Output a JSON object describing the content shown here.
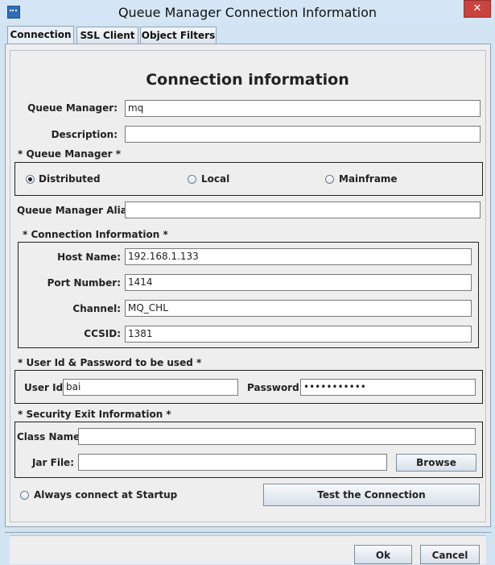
{
  "window": {
    "title": "Queue Manager Connection Information",
    "close_glyph": "✕"
  },
  "tabs": [
    {
      "label": "Connection",
      "active": true
    },
    {
      "label": "SSL Client",
      "active": false
    },
    {
      "label": "Object Filters",
      "active": false
    }
  ],
  "form": {
    "heading": "Connection information",
    "queue_manager_label": "Queue Manager:",
    "queue_manager_value": "mq",
    "description_label": "Description:",
    "description_value": "",
    "qm_type_title": "* Queue Manager *",
    "qm_type_options": [
      {
        "label": "Distributed",
        "selected": true
      },
      {
        "label": "Local",
        "selected": false
      },
      {
        "label": "Mainframe",
        "selected": false
      }
    ],
    "alias_label": "Queue Manager Alias:",
    "alias_value": "",
    "conn_title": "* Connection Information *",
    "host_label": "Host Name:",
    "host_value": "192.168.1.133",
    "port_label": "Port Number:",
    "port_value": "1414",
    "channel_label": "Channel:",
    "channel_value": "MQ_CHL",
    "ccsid_label": "CCSID:",
    "ccsid_value": "1381",
    "cred_title": "* User Id & Password to be used *",
    "userid_label": "User Id:",
    "userid_value": "bai",
    "password_label": "Password:",
    "password_value": "•••••••••••",
    "security_title": "* Security Exit Information *",
    "class_label": "Class Name:",
    "class_value": "",
    "jar_label": "Jar File:",
    "jar_value": "",
    "browse_label": "Browse",
    "startup_label": "Always connect at Startup",
    "test_label": "Test the Connection"
  },
  "footer": {
    "ok_label": "Ok",
    "cancel_label": "Cancel"
  }
}
